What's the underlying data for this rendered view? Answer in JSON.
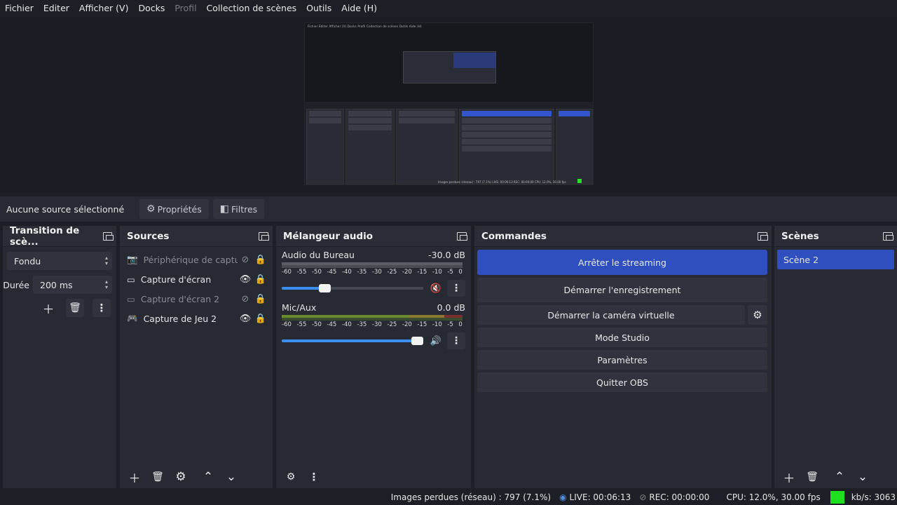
{
  "menubar": {
    "items": [
      "Fichier",
      "Editer",
      "Afficher (V)",
      "Docks",
      "Profil",
      "Collection de scènes",
      "Outils",
      "Aide (H)"
    ]
  },
  "preview": {
    "mini_menu": "Fichier  Editer  Afficher (V)  Docks  Profil  Collection de scènes  Outils  Aide (H)",
    "mini_status": "Images perdues (réseau) : 797 (7.1%)   LIVE: 00:06:13   REC: 00:00:00   CPU: 12.0%, 30.00 fps"
  },
  "source_bar": {
    "label": "Aucune source sélectionné",
    "properties": "Propriétés",
    "filters": "Filtres"
  },
  "transition": {
    "title": "Transition de scè...",
    "type": "Fondu",
    "duration_label": "Durée",
    "duration_value": "200 ms"
  },
  "sources": {
    "title": "Sources",
    "items": [
      {
        "label": "Périphérique de captu",
        "icon": "camera-icon",
        "visible": false
      },
      {
        "label": "Capture d'écran",
        "icon": "monitor-icon",
        "visible": true
      },
      {
        "label": "Capture d'écran 2",
        "icon": "monitor-icon",
        "visible": false
      },
      {
        "label": "Capture de Jeu 2",
        "icon": "gamepad-icon",
        "visible": true
      }
    ]
  },
  "mixer": {
    "title": "Mélangeur audio",
    "ticks": [
      "-60",
      "-55",
      "-50",
      "-45",
      "-40",
      "-35",
      "-30",
      "-25",
      "-20",
      "-15",
      "-10",
      "-5",
      "0"
    ],
    "channels": [
      {
        "name": "Audio du Bureau",
        "db": "-30.0 dB",
        "volume": 0.3,
        "muted": true
      },
      {
        "name": "Mic/Aux",
        "db": "0.0 dB",
        "volume": 1.0,
        "muted": false
      }
    ]
  },
  "commands": {
    "title": "Commandes",
    "stop_streaming": "Arrêter le streaming",
    "start_recording": "Démarrer l'enregistrement",
    "virtual_camera": "Démarrer la caméra virtuelle",
    "studio_mode": "Mode Studio",
    "settings": "Paramètres",
    "quit": "Quitter OBS"
  },
  "scenes": {
    "title": "Scènes",
    "items": [
      "Scène 2"
    ]
  },
  "status": {
    "dropped": "Images perdues (réseau) : 797 (7.1%)",
    "live": "LIVE: 00:06:13",
    "rec": "REC: 00:00:00",
    "cpu": "CPU: 12.0%, 30.00 fps",
    "kbs": "kb/s: 3063",
    "health_color": "#1fe01f"
  },
  "colors": {
    "accent": "#2f4fbf",
    "panel": "#272a33",
    "background": "#1d1f26"
  }
}
